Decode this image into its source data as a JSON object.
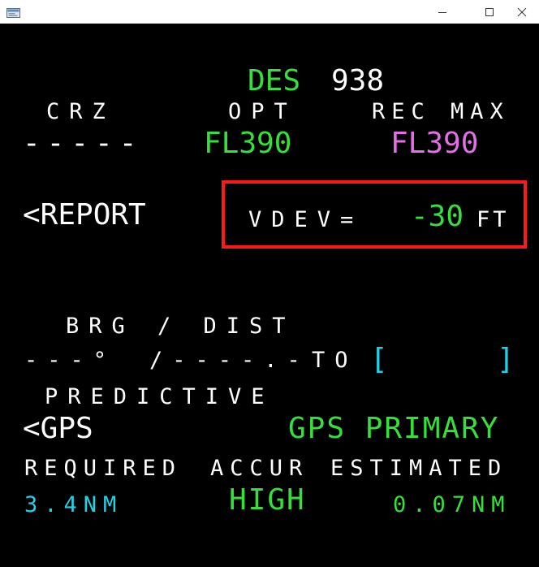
{
  "window": {
    "title": "",
    "icon": "app-window-icon",
    "controls": [
      "minimize-icon",
      "maximize-icon",
      "close-icon"
    ]
  },
  "fmc": {
    "title_mode": "DES",
    "title_value": "938",
    "crz_label": "CRZ",
    "crz_value": "-----",
    "opt_label": "OPT",
    "opt_value": "FL390",
    "rec_max_label": "REC MAX",
    "rec_max_value": "FL390",
    "report_label": "<REPORT",
    "vdev_label": "VDEV=",
    "vdev_value": "-30",
    "vdev_unit": "FT",
    "brg_dist_label": "BRG / DIST",
    "brg_value": "---°",
    "dist_value": "/----.-",
    "to_label": "TO",
    "to_open_bracket": "[",
    "to_close_bracket": "]",
    "predictive_label": "PREDICTIVE",
    "gps_label": "<GPS",
    "gps_status": "GPS PRIMARY",
    "required_label": "REQUIRED",
    "accur_label": "ACCUR",
    "estimated_label": "ESTIMATED",
    "required_value": "3.4NM",
    "accur_value": "HIGH",
    "estimated_value": "0.07NM"
  },
  "colors": {
    "background": "#000000",
    "white": "#ffffff",
    "green": "#35e03a",
    "magenta": "#e56ee8",
    "cyan": "#1fd2e8",
    "highlight": "#ff1a1a"
  }
}
